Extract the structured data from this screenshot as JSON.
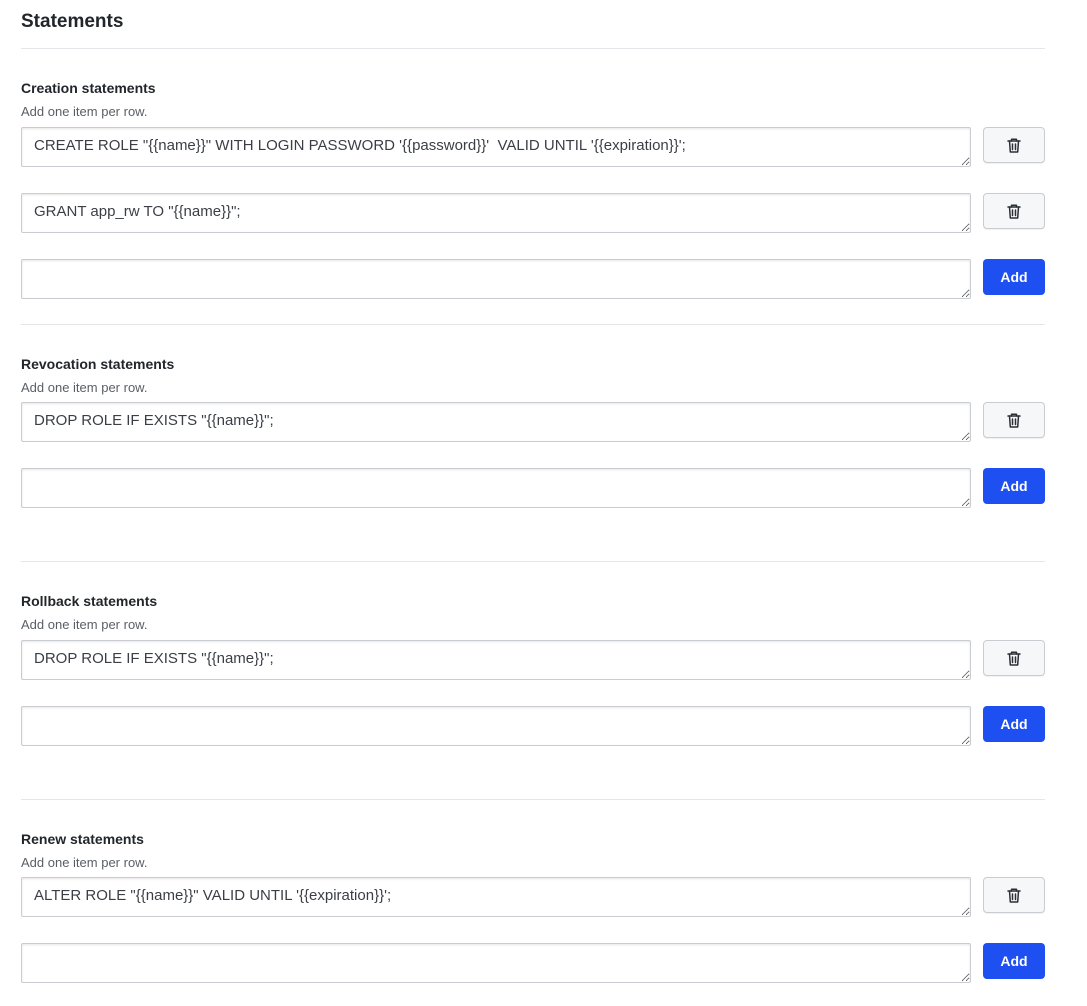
{
  "page": {
    "title": "Statements"
  },
  "sections": {
    "creation": {
      "title": "Creation statements",
      "help": "Add one item per row.",
      "rows": [
        "CREATE ROLE \"{{name}}\" WITH LOGIN PASSWORD '{{password}}'  VALID UNTIL '{{expiration}}';",
        "GRANT app_rw TO \"{{name}}\";"
      ],
      "new_value": ""
    },
    "revocation": {
      "title": "Revocation statements",
      "help": "Add one item per row.",
      "rows": [
        "DROP ROLE IF EXISTS \"{{name}}\";"
      ],
      "new_value": ""
    },
    "rollback": {
      "title": "Rollback statements",
      "help": "Add one item per row.",
      "rows": [
        "DROP ROLE IF EXISTS \"{{name}}\";"
      ],
      "new_value": ""
    },
    "renew": {
      "title": "Renew statements",
      "help": "Add one item per row.",
      "rows": [
        "ALTER ROLE \"{{name}}\" VALID UNTIL '{{expiration}}';"
      ],
      "new_value": ""
    }
  },
  "buttons": {
    "add_label": "Add"
  },
  "icons": {
    "delete": "trash-icon"
  },
  "colors": {
    "accent": "#1d4ff1",
    "divider": "#e4e6ea"
  }
}
